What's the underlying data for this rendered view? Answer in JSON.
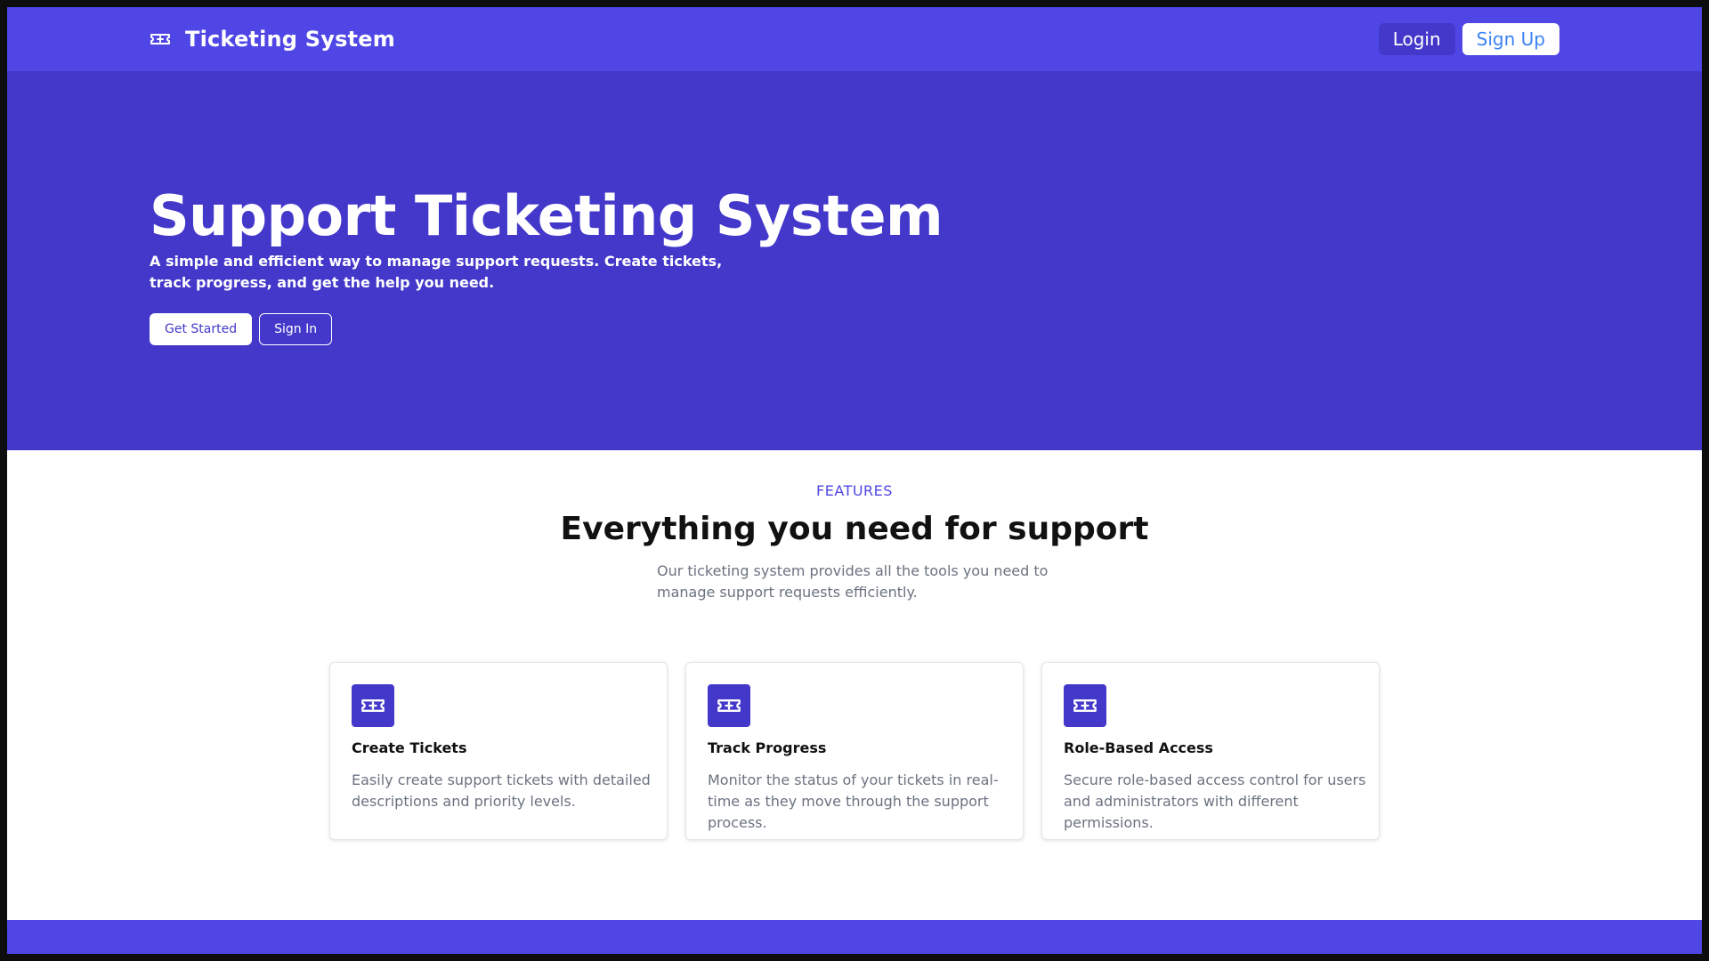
{
  "nav": {
    "brand_icon": "ticket-icon",
    "brand_title": "Ticketing System",
    "login_label": "Login",
    "signup_label": "Sign Up"
  },
  "hero": {
    "title": "Support Ticketing System",
    "subtitle": "A simple and efficient way to manage support requests. Create tickets, track progress, and get the help you need.",
    "get_started_label": "Get Started",
    "sign_in_label": "Sign In"
  },
  "features": {
    "eyebrow": "FEATURES",
    "title": "Everything you need for support",
    "description": "Our ticketing system provides all the tools you need to manage support requests efficiently.",
    "cards": [
      {
        "icon": "ticket-icon",
        "title": "Create Tickets",
        "description": "Easily create support tickets with detailed descriptions and priority levels."
      },
      {
        "icon": "ticket-icon",
        "title": "Track Progress",
        "description": "Monitor the status of your tickets in real-time as they move through the support process."
      },
      {
        "icon": "ticket-icon",
        "title": "Role-Based Access",
        "description": "Secure role-based access control for users and administrators with different permissions."
      }
    ]
  },
  "colors": {
    "nav_bg": "#4f46e5",
    "hero_bg": "#4338ca",
    "accent": "#4f46e5",
    "signup_text": "#3b82f6"
  }
}
